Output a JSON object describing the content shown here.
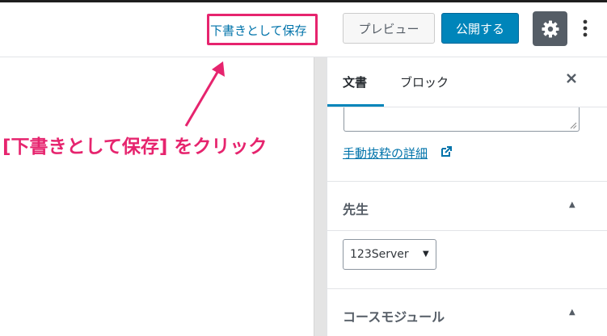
{
  "header": {
    "save_draft_label": "下書きとして保存",
    "preview_label": "プレビュー",
    "publish_label": "公開する",
    "settings_icon": "gear-icon",
    "more_icon": "vertical-ellipsis-icon"
  },
  "annotation": {
    "callout_text": "[下書きとして保存] をクリック",
    "color": "#e6246e"
  },
  "sidebar": {
    "tabs": [
      {
        "label": "文書",
        "active": true
      },
      {
        "label": "ブロック",
        "active": false
      }
    ],
    "close_icon": "close-icon",
    "excerpt_learn_more": "手動抜粋の詳細",
    "panels": [
      {
        "title": "先生",
        "expanded": true,
        "select_value": "123Server"
      },
      {
        "title": "コースモジュール",
        "expanded": true
      }
    ]
  },
  "colors": {
    "accent": "#0085ba",
    "link": "#0073aa",
    "settings_bg": "#555d66"
  }
}
